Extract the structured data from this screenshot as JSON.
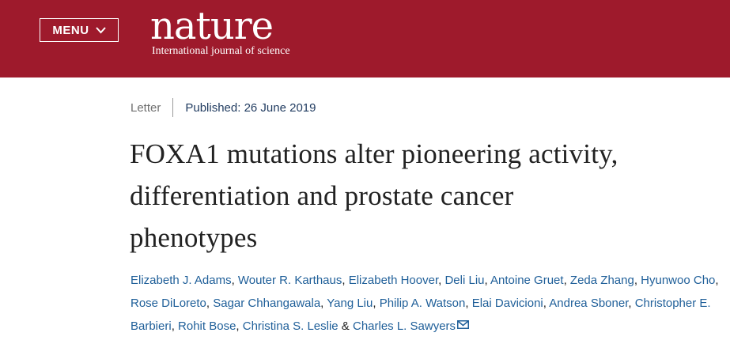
{
  "header": {
    "menu_label": "MENU",
    "logo_word": "nature",
    "logo_tagline": "International journal of science",
    "bg_color": "#9e1a2c"
  },
  "article": {
    "type": "Letter",
    "published": "Published: 26 June 2019",
    "title_lines": [
      "FOXA1 mutations alter pioneering activity,",
      "differentiation and prostate cancer",
      "phenotypes"
    ],
    "authors": [
      "Elizabeth J. Adams",
      "Wouter R. Karthaus",
      "Elizabeth Hoover",
      "Deli Liu",
      "Antoine Gruet",
      "Zeda Zhang",
      "Hyunwoo Cho",
      "Rose DiLoreto",
      "Sagar Chhangawala",
      "Yang Liu",
      "Philip A. Watson",
      "Elai Davicioni",
      "Andrea Sboner",
      "Christopher E. Barbieri",
      "Rohit Bose",
      "Christina S. Leslie",
      "Charles L. Sawyers"
    ],
    "author_separator": ", ",
    "last_joiner": " & ",
    "corresponding_icon": "envelope-icon"
  }
}
